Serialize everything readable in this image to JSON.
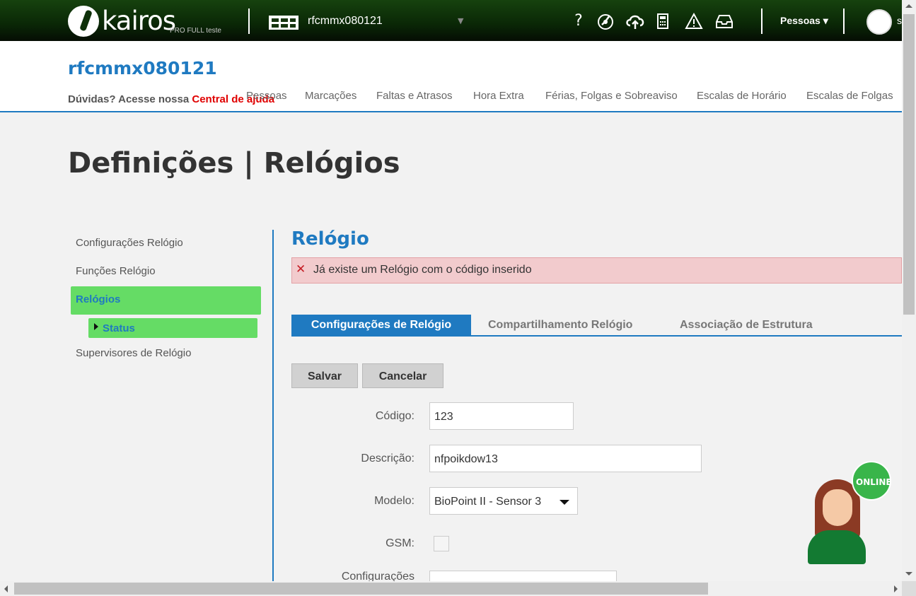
{
  "brand": {
    "name": "kairos",
    "subtitle": "PRO FULL teste"
  },
  "topbar": {
    "company": "rfcmmx080121",
    "icons": [
      "help-icon",
      "dashboard-icon",
      "cloud-upload-icon",
      "calculator-icon",
      "warning-icon",
      "inbox-icon"
    ],
    "pessoas_menu": "Pessoas",
    "user_initial": "s"
  },
  "header": {
    "title": "rfcmmx080121",
    "help_prefix": "Dúvidas? Acesse nossa ",
    "help_link": "Central de ajuda",
    "nav": [
      "Pessoas",
      "Marcações",
      "Faltas e Atrasos",
      "Hora Extra",
      "Férias, Folgas e Sobreaviso",
      "Escalas de Horário",
      "Escalas de Folgas"
    ]
  },
  "page_title": "Definições | Relógios",
  "side_menu": {
    "items": [
      "Configurações Relógio",
      "Funções Relógio",
      "Relógios",
      "Supervisores de Relógio"
    ],
    "sub_item": "Status"
  },
  "section_title": "Relógio",
  "alert": {
    "message": "Já existe um Relógio com o código inserido",
    "color": "#f2cbcd"
  },
  "tabs": [
    "Configurações de Relógio",
    "Compartilhamento Relógio",
    "Associação de Estrutura"
  ],
  "buttons": {
    "save": "Salvar",
    "cancel": "Cancelar"
  },
  "form": {
    "codigo_label": "Código:",
    "codigo_value": "123",
    "descricao_label": "Descrição:",
    "descricao_value": "nfpoikdow13",
    "modelo_label": "Modelo:",
    "modelo_value": "BioPoint II - Sensor 3",
    "gsm_label": "GSM:",
    "config_label": "Configurações"
  },
  "chat": {
    "status": "ONLINE"
  },
  "colors": {
    "brand_blue": "#1f7ac1",
    "active_green": "#65dc65",
    "topbar_green": "#0a2706"
  }
}
